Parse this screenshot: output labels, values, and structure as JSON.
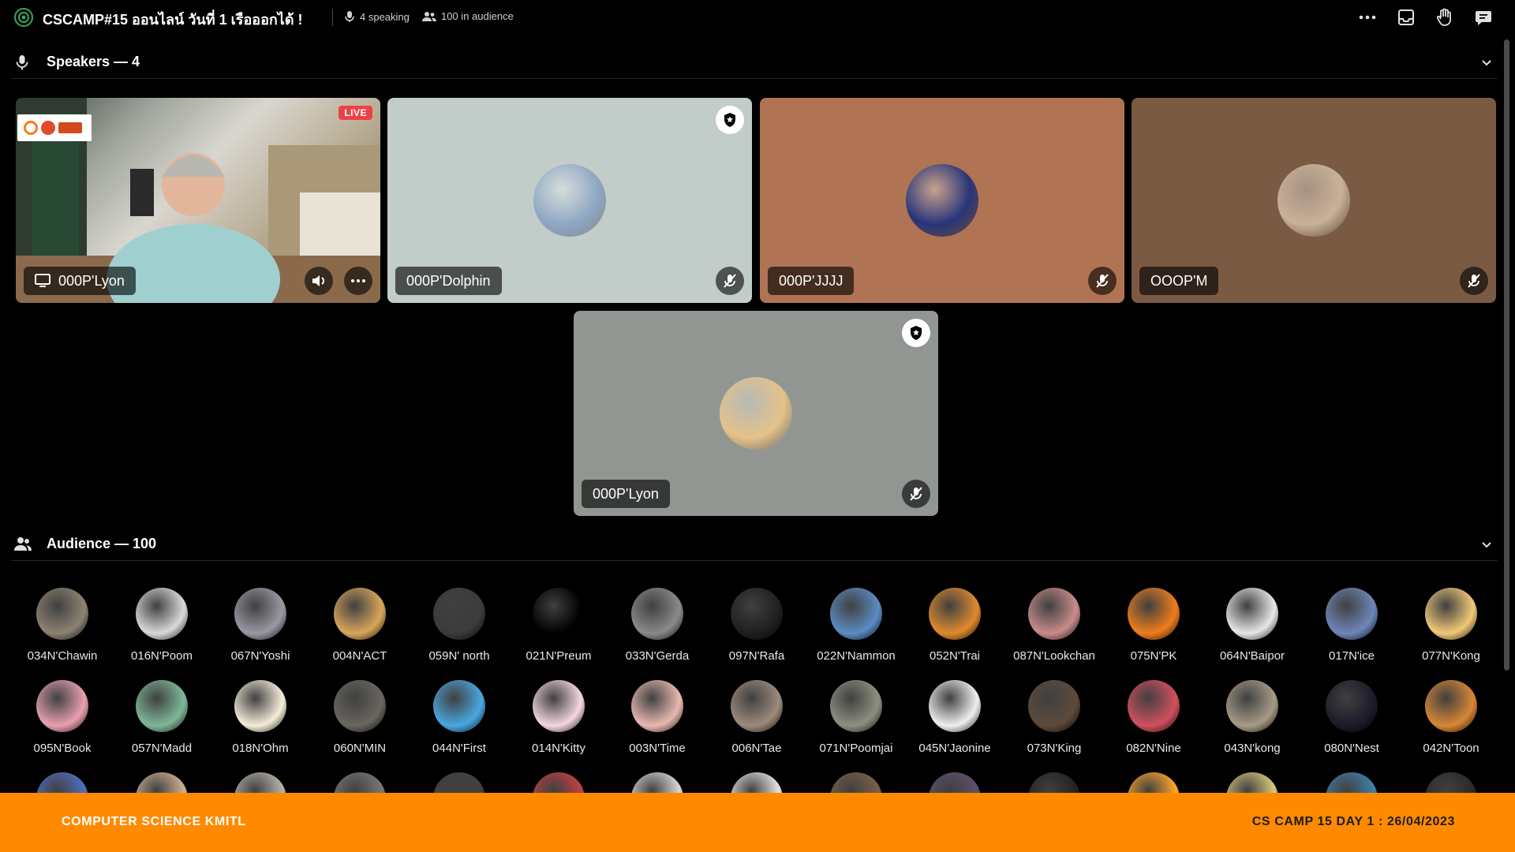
{
  "header": {
    "title": "CSCAMP#15 ออนไลน์ วันที่ 1 เรือออกได้ !",
    "speaking": "4 speaking",
    "audience": "100 in audience",
    "icons": [
      "stage-icon",
      "mic-icon",
      "people-icon",
      "more-icon",
      "inbox-icon",
      "hand-icon",
      "chat-icon"
    ]
  },
  "speakers": {
    "title": "Speakers — 4",
    "tiles": [
      {
        "name": "000P'Lyon",
        "type": "stream",
        "badge": "LIVE",
        "icon": "screen-share-icon"
      },
      {
        "name": "000P'Dolphin",
        "bg": "#c2ccc9",
        "moderator": true,
        "muted": true,
        "avatar": "#8fa7c4"
      },
      {
        "name": "000P'JJJJ",
        "bg": "#b07454",
        "muted": true,
        "avatar": "#27357a"
      },
      {
        "name": "OOOP'M",
        "bg": "#7b5a44",
        "muted": true,
        "avatar": "#c9b198"
      },
      {
        "name": "000P'Lyon",
        "bg": "#929692",
        "moderator": true,
        "muted": true,
        "avatar": "#e4c28a"
      }
    ]
  },
  "audience": {
    "title": "Audience — 100",
    "members": [
      {
        "name": "034N'Chawin",
        "color": "#8d8272"
      },
      {
        "name": "016N'Poom",
        "color": "#d9d9d9"
      },
      {
        "name": "067N'Yoshi",
        "color": "#9a98a4"
      },
      {
        "name": "004N'ACT",
        "color": "#d9a65b"
      },
      {
        "name": "059N' north",
        "color": "#3b3b3b"
      },
      {
        "name": "021N'Preum",
        "color": "#000000"
      },
      {
        "name": "033N'Gerda",
        "color": "#8a8a8a"
      },
      {
        "name": "097N'Rafa",
        "color": "#1f1f1f"
      },
      {
        "name": "022N'Nammon",
        "color": "#5b8cc3"
      },
      {
        "name": "052N'Trai",
        "color": "#e08a2e"
      },
      {
        "name": "087N'Lookchan",
        "color": "#c98b8b"
      },
      {
        "name": "075N'PK",
        "color": "#f07d1c"
      },
      {
        "name": "064N'Baipor",
        "color": "#e7e7e7"
      },
      {
        "name": "017N'ice",
        "color": "#6e86b8"
      },
      {
        "name": "077N'Kong",
        "color": "#f1c878"
      },
      {
        "name": "095N'Book",
        "color": "#e9a0b2"
      },
      {
        "name": "057N'Madd",
        "color": "#7fb89a"
      },
      {
        "name": "018N'Ohm",
        "color": "#f5ecd9"
      },
      {
        "name": "060N'MIN",
        "color": "#6a6660"
      },
      {
        "name": "044N'First",
        "color": "#4aa7e0"
      },
      {
        "name": "014N'Kitty",
        "color": "#f4d6e2"
      },
      {
        "name": "003N'Time",
        "color": "#e9b9b0"
      },
      {
        "name": "006N'Tae",
        "color": "#9c8b7c"
      },
      {
        "name": "071N'Poomjai",
        "color": "#8d9080"
      },
      {
        "name": "045N'Jaonine",
        "color": "#efefef"
      },
      {
        "name": "073N'King",
        "color": "#5c4a3b"
      },
      {
        "name": "082N'Nine",
        "color": "#d0505e"
      },
      {
        "name": "043N'kong",
        "color": "#a79a87"
      },
      {
        "name": "080N'Nest",
        "color": "#1b1b2a"
      },
      {
        "name": "042N'Toon",
        "color": "#d98635"
      }
    ],
    "peek_colors": [
      "#4f6fc0",
      "#cfb08f",
      "#b9b2a8",
      "#777777",
      "#414141",
      "#c24141",
      "#d8d8d8",
      "#e4e4e4",
      "#7a6046",
      "#5e4f6b",
      "#222222",
      "#ffa629",
      "#d8c77a",
      "#3f7fa8",
      "#2a2a2a"
    ]
  },
  "footer": {
    "left": "COMPUTER SCIENCE KMITL",
    "right": "CS CAMP 15 DAY 1 : 26/04/2023"
  },
  "colors": {
    "footer_bg": "#ff8a00",
    "live": "#ed4245",
    "stage_icon": "#3ba55c"
  }
}
